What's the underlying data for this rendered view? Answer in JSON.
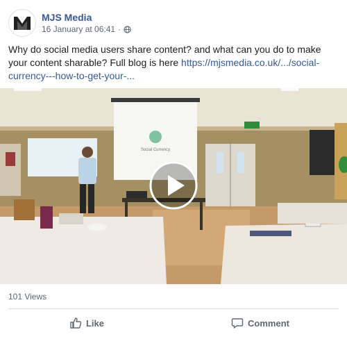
{
  "post": {
    "page_name": "MJS Media",
    "timestamp": "16 January at 06:41",
    "separator": "·",
    "text": "Why do social media users share content? and what can you do to make your content sharable? Full blog is here ",
    "link_text": "https://mjsmedia.co.uk/.../social-currency---how-to-get-your-..."
  },
  "video": {
    "slide_text": "Social Currency",
    "play_icon": "play-icon"
  },
  "footer": {
    "views": "101 Views",
    "like_label": "Like",
    "comment_label": "Comment"
  },
  "icons": {
    "avatar": "mjs-logo",
    "privacy": "globe-icon",
    "like": "thumbs-up-icon",
    "comment": "comment-icon"
  },
  "colors": {
    "link": "#385898",
    "secondary_text": "#606770"
  }
}
